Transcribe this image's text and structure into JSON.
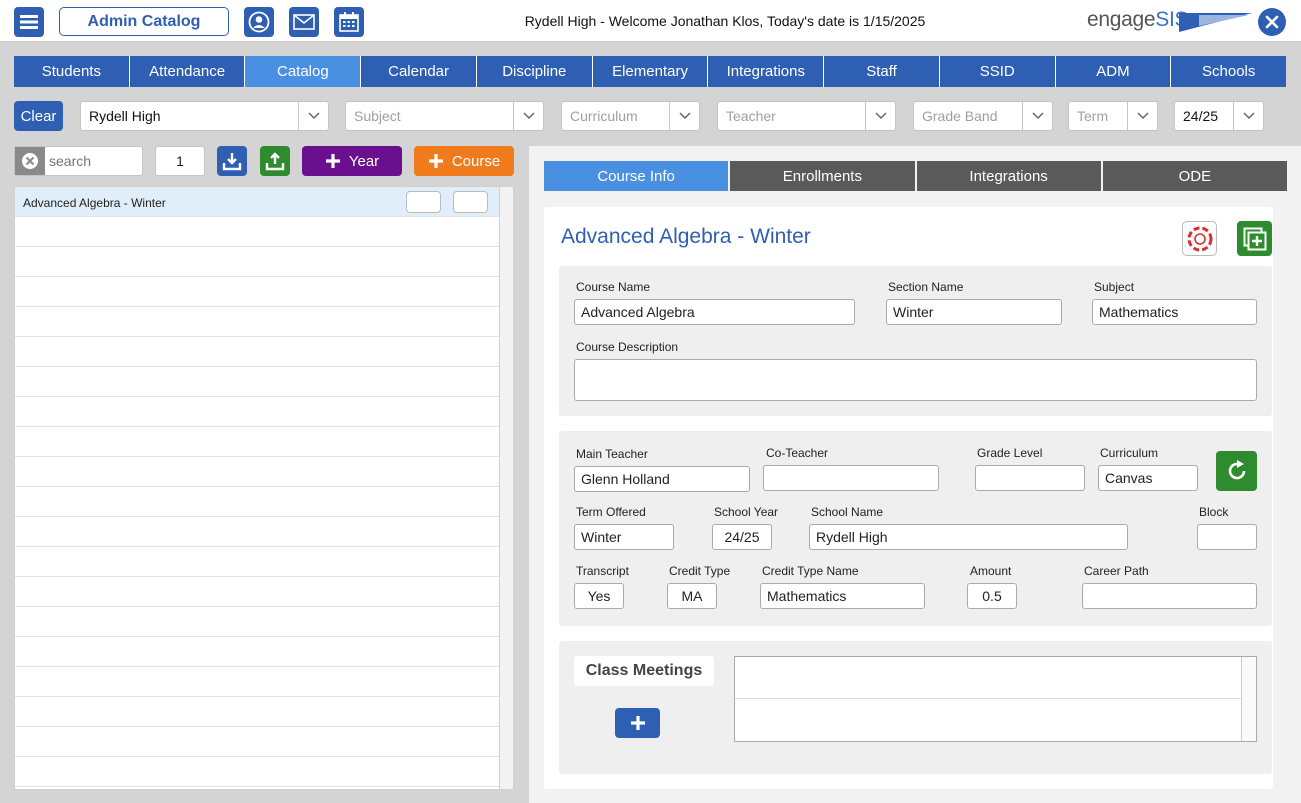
{
  "header": {
    "page_button_label": "Admin Catalog",
    "welcome_text": "Rydell High - Welcome Jonathan Klos, Today's date is 1/15/2025",
    "logo_text_a": "engage",
    "logo_text_b": "SIS",
    "brand_color": "#2f5fb3"
  },
  "nav": {
    "tabs": [
      "Students",
      "Attendance",
      "Catalog",
      "Calendar",
      "Discipline",
      "Elementary",
      "Integrations",
      "Staff",
      "SSID",
      "ADM",
      "Schools"
    ],
    "active": "Catalog"
  },
  "filters": {
    "clear_label": "Clear",
    "school": "Rydell High",
    "subject_placeholder": "Subject",
    "curriculum_placeholder": "Curriculum",
    "teacher_placeholder": "Teacher",
    "grade_band_placeholder": "Grade Band",
    "term_placeholder": "Term",
    "year": "24/25"
  },
  "list_tools": {
    "search_placeholder": "search",
    "page": "1",
    "year_label": "Year",
    "course_label": "Course"
  },
  "course_list": {
    "items": [
      "Advanced Algebra - Winter"
    ]
  },
  "detail_tabs": [
    "Course Info",
    "Enrollments",
    "Integrations",
    "ODE"
  ],
  "course": {
    "title": "Advanced Algebra - Winter",
    "labels": {
      "course_name": "Course Name",
      "section_name": "Section Name",
      "subject": "Subject",
      "course_description": "Course Description",
      "main_teacher": "Main Teacher",
      "co_teacher": "Co-Teacher",
      "grade_level": "Grade Level",
      "curriculum": "Curriculum",
      "term_offered": "Term Offered",
      "school_year": "School Year",
      "school_name": "School Name",
      "block": "Block",
      "transcript": "Transcript",
      "credit_type": "Credit Type",
      "credit_type_name": "Credit Type Name",
      "amount": "Amount",
      "career_path": "Career Path"
    },
    "values": {
      "course_name": "Advanced Algebra",
      "section_name": "Winter",
      "subject": "Mathematics",
      "course_description": "",
      "main_teacher": "Glenn Holland",
      "co_teacher": "",
      "grade_level": "",
      "curriculum": "Canvas",
      "term_offered": "Winter",
      "school_year": "24/25",
      "school_name": "Rydell High",
      "block": "",
      "transcript": "Yes",
      "credit_type": "MA",
      "credit_type_name": "Mathematics",
      "amount": "0.5",
      "career_path": ""
    }
  },
  "class_meetings": {
    "label": "Class Meetings"
  }
}
